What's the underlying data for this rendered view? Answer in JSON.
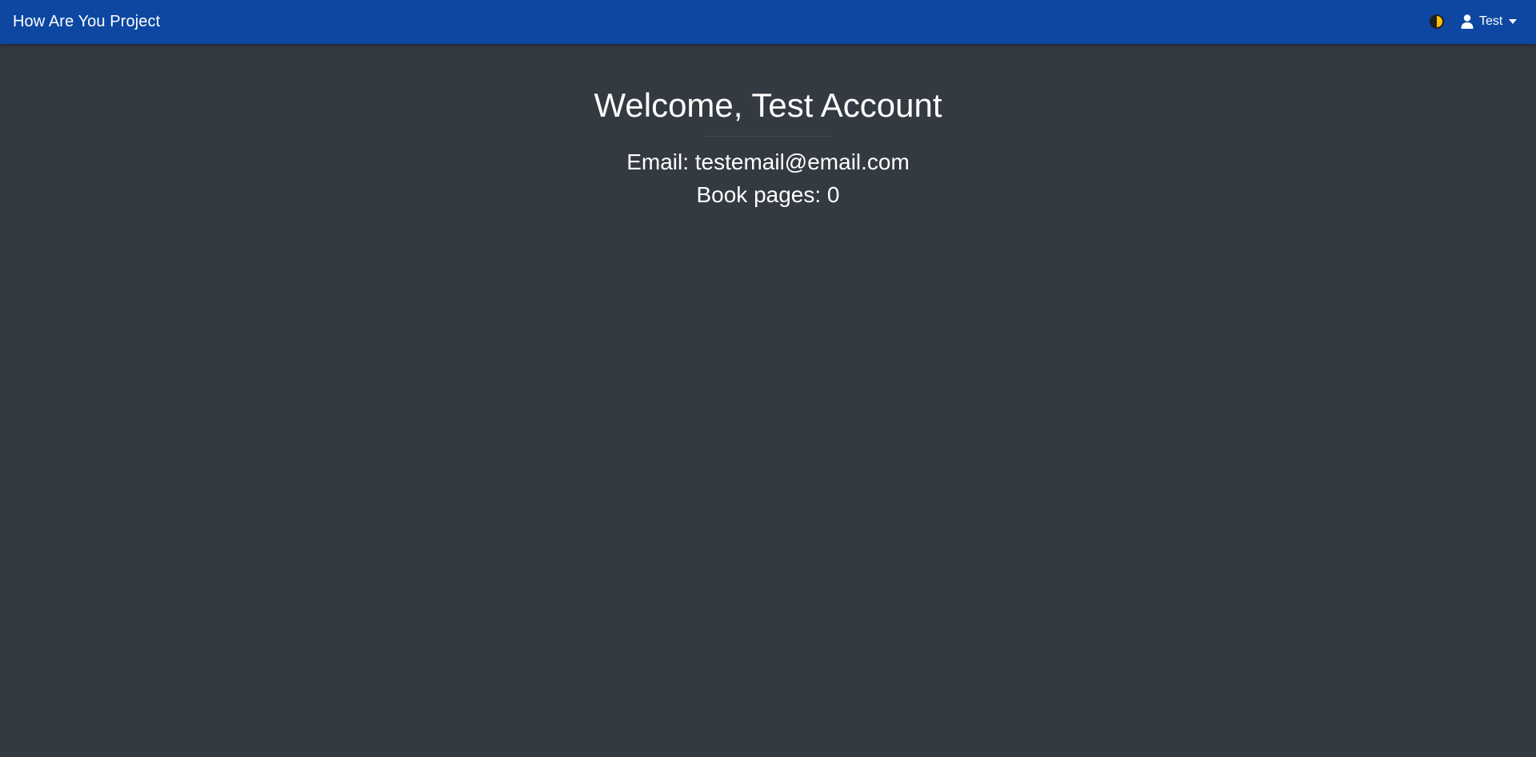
{
  "navbar": {
    "brand": "How Are You Project",
    "theme_toggle_icon": "half-circle-contrast-icon",
    "user_icon": "user-icon",
    "user_label": "Test",
    "user_caret_icon": "caret-down-icon"
  },
  "profile": {
    "welcome": "Welcome, Test Account",
    "email_line": "Email: testemail@email.com",
    "book_pages_line": "Book pages: 0"
  },
  "colors": {
    "navbar_bg": "#0d47a1",
    "page_bg": "#343a41",
    "text": "#ffffff",
    "toggle_accent": "#ffc107"
  }
}
